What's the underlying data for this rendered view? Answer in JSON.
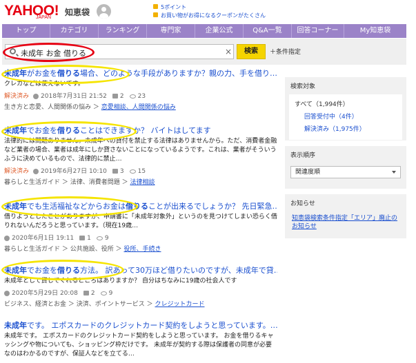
{
  "header": {
    "logo": "YAHOO!",
    "logo_sub": "JAPAN",
    "service": "知恵袋",
    "promo1": "5ポイント",
    "promo2": "お買い物がお得になるクーポンがたくさん"
  },
  "nav": [
    "トップ",
    "カテゴリ",
    "ランキング",
    "専門家",
    "企業公式",
    "Q&A一覧",
    "回答コーナー",
    "My知恵袋"
  ],
  "search": {
    "query": "未成年 お金 借りる",
    "button": "検索",
    "conditions": "条件指定"
  },
  "results": [
    {
      "title_bold1": "未成年",
      "title_mid": "がお金を",
      "title_bold2": "借りる",
      "title_rest": "場合、どのような手段がありますか？親の力、手を借り…",
      "snippet": "クレカなどは使えないです。",
      "status": "解決済み",
      "date": "2018年7月31日 21:52",
      "answers": "2",
      "views": "23",
      "cat1": "生き方と恋愛、人間関係の悩み",
      "cat2": "恋愛相談、人間関係の悩み"
    },
    {
      "title_bold1": "未成年",
      "title_mid": "でお金を",
      "title_bold2": "借りる",
      "title_rest": "ことはできますか？ バイトはしてます",
      "snippet": "法律的には問題ありません。未成年への貸付を禁止する法律はありませんから。ただ、消費者金融など業者の場合、業者は成年にしか貸さないことになっているようです。これは、業者がそういうふうに決めているもので、法律的に禁止…",
      "status": "解決済み",
      "date": "2019年6月27日 10:10",
      "answers": "3",
      "views": "15",
      "cat1": "暮らしと生活ガイド ＞ 法律、消費者問題",
      "cat2": "法律相談"
    },
    {
      "title_bold1": "未成年",
      "title_mid": "でも生活福祉などからお金は",
      "title_bold2": "借りる",
      "title_rest": "ことが出来るでしょうか？ 先日緊急…",
      "snippet": "借りようとしたことがありますが、申請書に「未成年対象外」というのを見つけてしまい恐らく借りれないんだろうと思っています。（現在19歳…",
      "status": "",
      "date": "2020年6月1日 19:11",
      "answers": "1",
      "views": "9",
      "cat1": "暮らしと生活ガイド ＞ 公共施設、役所",
      "cat2": "役所、手続き"
    },
    {
      "title_bold1": "未成年",
      "title_mid": "でお金を",
      "title_bold2": "借りる",
      "title_rest": "方法。 訳あって30万ほど借りたいのですが、未成年で貸…",
      "snippet": "未成年として貸してくれるところはありますか？ 自分はちなみに19歳の社会人です",
      "status": "",
      "date": "2020年5月29日 20:08",
      "answers": "2",
      "views": "9",
      "cat1": "ビジネス、経済とお金 ＞ 決済、ポイントサービス",
      "cat2": "クレジットカード"
    },
    {
      "title_bold1": "未成年",
      "title_mid": "です。 エポスカードのクレジットカード契約をしようと思っています。…",
      "title_bold2": "",
      "title_rest": "",
      "snippet": "未成年です。 エポスカードのクレジットカード契約をしようと思っています。 お金を借りるキャッシングや物についても、ショッピング枠だけです。 未成年が契約する際は保護者の同意が必要なのはわかるのですが、保証人などを立てる…",
      "status": "",
      "date": "",
      "answers": "",
      "views": "",
      "cat1": "",
      "cat2": ""
    }
  ],
  "sidebar": {
    "target_heading": "検索対象",
    "all": "すべて（1,994件）",
    "open": "回答受付中（4件）",
    "solved": "解決済み（1,975件）",
    "order_heading": "表示順序",
    "order_value": "関連度順",
    "notice_heading": "お知らせ",
    "notice_text": "知恵袋検索条件指定「エリア」廃止のお知らせ"
  }
}
